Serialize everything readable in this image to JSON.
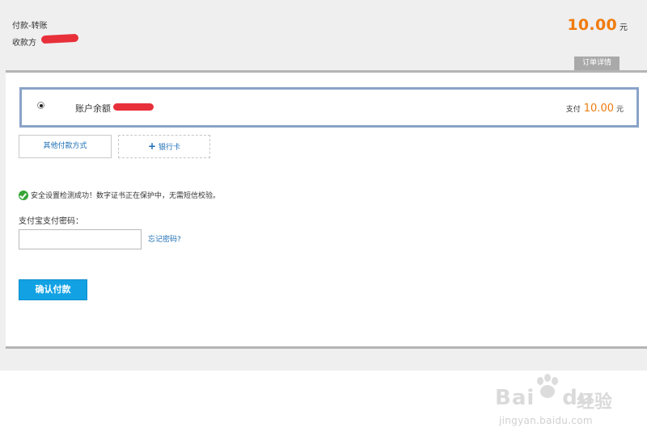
{
  "header": {
    "title": "付款-转账",
    "payee_label": "收款方",
    "amount": "10.00",
    "amount_unit": "元",
    "order_details": "订单详情"
  },
  "balance": {
    "label": "账户余额",
    "pay_label": "支付",
    "pay_amount": "10.00",
    "pay_unit": "元"
  },
  "methods": {
    "other": "其他付款方式",
    "bank_plus": "+",
    "bank": "银行卡"
  },
  "security": {
    "message": "安全设置检测成功！数字证书正在保护中，无需短信校验。"
  },
  "password": {
    "label": "支付宝支付密码：",
    "value": "",
    "forgot": "忘记密码?"
  },
  "confirm": "确认付款",
  "watermark": {
    "brand": "Bai",
    "brand_suffix": "du",
    "cn": "经验",
    "url": "jingyan.baidu.com"
  },
  "colors": {
    "accent_orange": "#f07b0d",
    "link_blue": "#1a6eb5",
    "button_blue": "#12a2e3",
    "success_green": "#37a536",
    "selected_border": "#8aa3c8"
  }
}
